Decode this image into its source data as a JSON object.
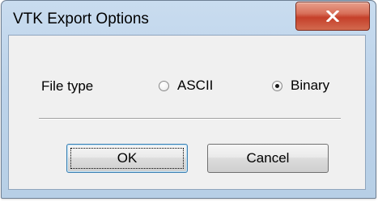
{
  "window": {
    "title": "VTK Export Options",
    "close_icon": "close-x-icon"
  },
  "form": {
    "file_type_label": "File type",
    "options": [
      {
        "label": "ASCII",
        "selected": false
      },
      {
        "label": "Binary",
        "selected": true
      }
    ]
  },
  "buttons": {
    "ok_label": "OK",
    "cancel_label": "Cancel"
  },
  "colors": {
    "close_button": "#c5402a",
    "dialog_face": "#f0f0f0",
    "frame": "#bcd3ea",
    "default_button_border": "#3c7fb1"
  }
}
